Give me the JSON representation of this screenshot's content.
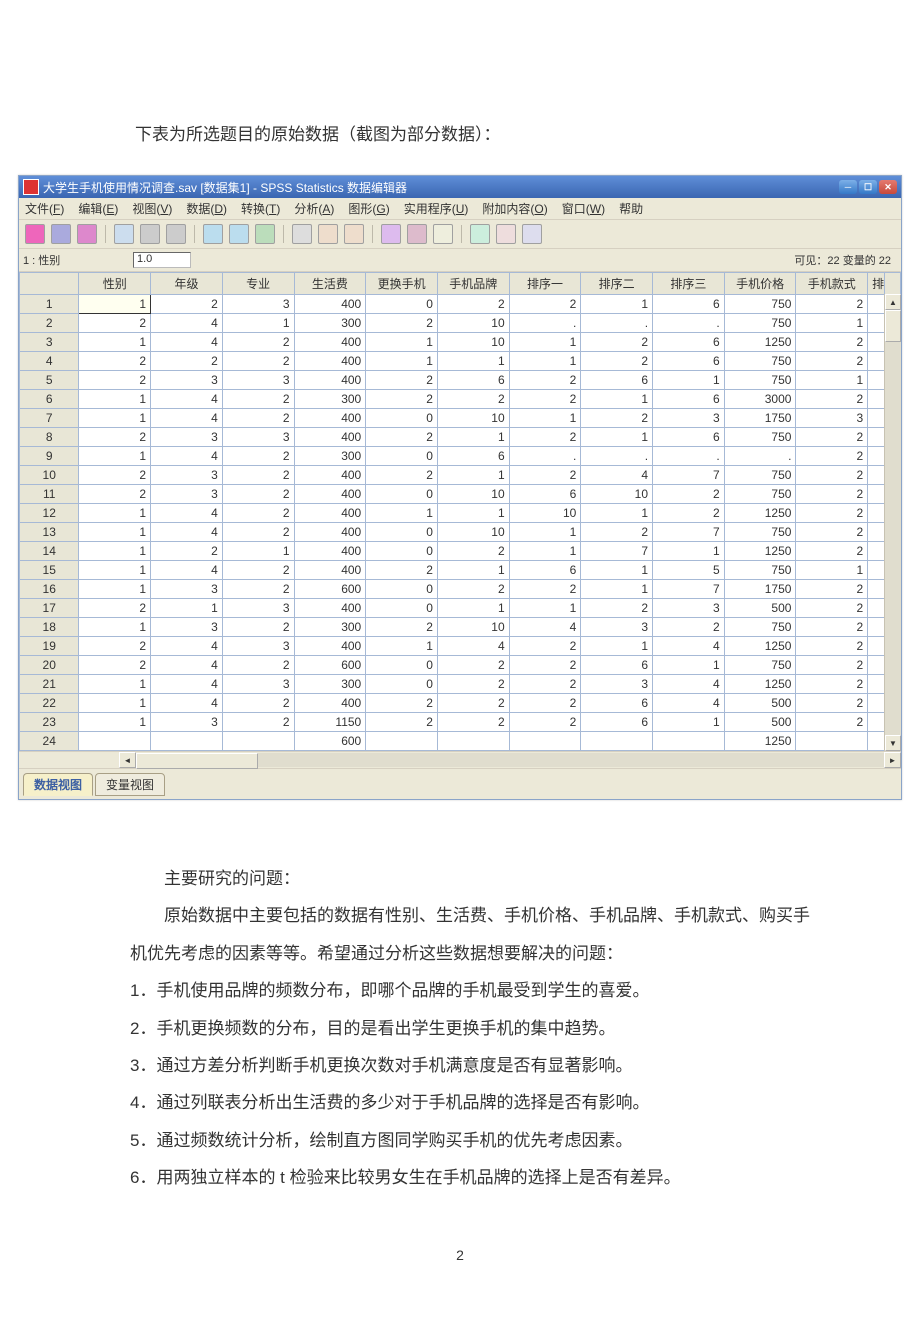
{
  "intro_text": "下表为所选题目的原始数据（截图为部分数据）：",
  "window": {
    "title": "大学生手机使用情况调查.sav [数据集1] - SPSS Statistics 数据编辑器"
  },
  "menubar": [
    {
      "label": "文件(",
      "u": "F",
      "after": ")"
    },
    {
      "label": "编辑(",
      "u": "E",
      "after": ")"
    },
    {
      "label": "视图(",
      "u": "V",
      "after": ")"
    },
    {
      "label": "数据(",
      "u": "D",
      "after": ")"
    },
    {
      "label": "转换(",
      "u": "T",
      "after": ")"
    },
    {
      "label": "分析(",
      "u": "A",
      "after": ")"
    },
    {
      "label": "图形(",
      "u": "G",
      "after": ")"
    },
    {
      "label": "实用程序(",
      "u": "U",
      "after": ")"
    },
    {
      "label": "附加内容(",
      "u": "O",
      "after": ")"
    },
    {
      "label": "窗口(",
      "u": "W",
      "after": ")"
    },
    {
      "label": "帮助",
      "u": "",
      "after": ""
    }
  ],
  "toolbar_icons": [
    "open-icon",
    "save-icon",
    "print-icon",
    "recent-icon",
    "undo-icon",
    "redo-icon",
    "goto-icon",
    "ascend-icon",
    "variables-icon",
    "find-icon",
    "insert-case-icon",
    "insert-var-icon",
    "split-icon",
    "weight-icon",
    "select-icon",
    "value-labels-icon",
    "missing-icon",
    "abc-icon"
  ],
  "cellbar": {
    "name": "1 : 性别",
    "value": "1.0",
    "right": "可见：22 变量的 22"
  },
  "columns": [
    "性别",
    "年级",
    "专业",
    "生活费",
    "更换手机",
    "手机品牌",
    "排序一",
    "排序二",
    "排序三",
    "手机价格",
    "手机款式"
  ],
  "extra_col_label": "排",
  "rows": [
    [
      1,
      2,
      3,
      400,
      0,
      2,
      2,
      1,
      6,
      750,
      2
    ],
    [
      2,
      4,
      1,
      300,
      2,
      10,
      ".",
      ".",
      ".",
      750,
      1
    ],
    [
      1,
      4,
      2,
      400,
      1,
      10,
      1,
      2,
      6,
      1250,
      2
    ],
    [
      2,
      2,
      2,
      400,
      1,
      1,
      1,
      2,
      6,
      750,
      2
    ],
    [
      2,
      3,
      3,
      400,
      2,
      6,
      2,
      6,
      1,
      750,
      1
    ],
    [
      1,
      4,
      2,
      300,
      2,
      2,
      2,
      1,
      6,
      3000,
      2
    ],
    [
      1,
      4,
      2,
      400,
      0,
      10,
      1,
      2,
      3,
      1750,
      3
    ],
    [
      2,
      3,
      3,
      400,
      2,
      1,
      2,
      1,
      6,
      750,
      2
    ],
    [
      1,
      4,
      2,
      300,
      0,
      6,
      ".",
      ".",
      ".",
      ".",
      2
    ],
    [
      2,
      3,
      2,
      400,
      2,
      1,
      2,
      4,
      7,
      750,
      2
    ],
    [
      2,
      3,
      2,
      400,
      0,
      10,
      6,
      10,
      2,
      750,
      2
    ],
    [
      1,
      4,
      2,
      400,
      1,
      1,
      10,
      1,
      2,
      1250,
      2
    ],
    [
      1,
      4,
      2,
      400,
      0,
      10,
      1,
      2,
      7,
      750,
      2
    ],
    [
      1,
      2,
      1,
      400,
      0,
      2,
      1,
      7,
      1,
      1250,
      2
    ],
    [
      1,
      4,
      2,
      400,
      2,
      1,
      6,
      1,
      5,
      750,
      1
    ],
    [
      1,
      3,
      2,
      600,
      0,
      2,
      2,
      1,
      7,
      1750,
      2
    ],
    [
      2,
      1,
      3,
      400,
      0,
      1,
      1,
      2,
      3,
      500,
      2
    ],
    [
      1,
      3,
      2,
      300,
      2,
      10,
      4,
      3,
      2,
      750,
      2
    ],
    [
      2,
      4,
      3,
      400,
      1,
      4,
      2,
      1,
      4,
      1250,
      2
    ],
    [
      2,
      4,
      2,
      600,
      0,
      2,
      2,
      6,
      1,
      750,
      2
    ],
    [
      1,
      4,
      3,
      300,
      0,
      2,
      2,
      3,
      4,
      1250,
      2
    ],
    [
      1,
      4,
      2,
      400,
      2,
      2,
      2,
      6,
      4,
      500,
      2
    ],
    [
      1,
      3,
      2,
      1150,
      2,
      2,
      2,
      6,
      1,
      500,
      2
    ]
  ],
  "last_partial_row": [
    "",
    "",
    "",
    600,
    "",
    "",
    "",
    "",
    "",
    1250,
    ""
  ],
  "tabs": {
    "data": "数据视图",
    "variable": "变量视图"
  },
  "body_text": {
    "heading": "主要研究的问题：",
    "p1": "原始数据中主要包括的数据有性别、生活费、手机价格、手机品牌、手机款式、购买手机优先考虑的因素等等。希望通过分析这些数据想要解决的问题：",
    "items": [
      "1．手机使用品牌的频数分布，即哪个品牌的手机最受到学生的喜爱。",
      "2．手机更换频数的分布，目的是看出学生更换手机的集中趋势。",
      "3．通过方差分析判断手机更换次数对手机满意度是否有显著影响。",
      "4．通过列联表分析出生活费的多少对于手机品牌的选择是否有影响。",
      "5．通过频数统计分析，绘制直方图同学购买手机的优先考虑因素。",
      "6．用两独立样本的 t 检验来比较男女生在手机品牌的选择上是否有差异。"
    ]
  },
  "page_number": "2"
}
